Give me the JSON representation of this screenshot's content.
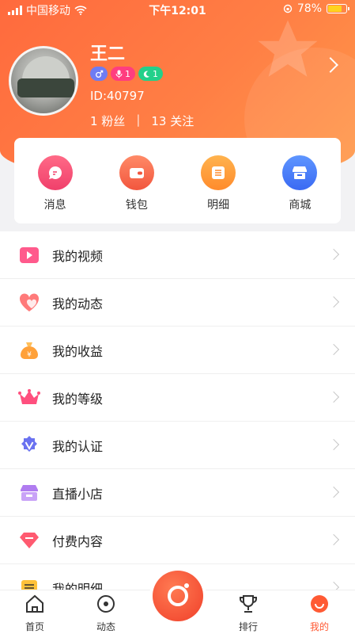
{
  "status_bar": {
    "carrier": "中国移动",
    "time": "下午12:01",
    "battery": "78%",
    "battery_level": 0.78
  },
  "profile": {
    "name": "王二",
    "badge_level_1": "1",
    "badge_level_2": "1",
    "id_text": "ID:40797",
    "fans": "1 粉丝",
    "separator": "|",
    "follows": "13 关注"
  },
  "quick_actions": [
    {
      "label": "消息",
      "icon": "message-icon"
    },
    {
      "label": "钱包",
      "icon": "wallet-icon"
    },
    {
      "label": "明细",
      "icon": "list-icon"
    },
    {
      "label": "商城",
      "icon": "store-icon"
    }
  ],
  "menu": [
    {
      "label": "我的视频",
      "icon": "video-icon",
      "color": "#ff5a8c"
    },
    {
      "label": "我的动态",
      "icon": "hearts-icon",
      "color": "#ff6f6f"
    },
    {
      "label": "我的收益",
      "icon": "moneybag-icon",
      "color": "#ffa13a"
    },
    {
      "label": "我的等级",
      "icon": "crown-icon",
      "color": "#ff4f7e"
    },
    {
      "label": "我的认证",
      "icon": "verified-icon",
      "color": "#6a72f0"
    },
    {
      "label": "直播小店",
      "icon": "shop-icon",
      "color": "#b07cf0"
    },
    {
      "label": "付费内容",
      "icon": "diamond-icon",
      "color": "#ff5a70"
    },
    {
      "label": "我的明细",
      "icon": "detail-icon",
      "color": "#ffc23a"
    }
  ],
  "tabbar": [
    {
      "label": "首页",
      "icon": "home-icon"
    },
    {
      "label": "动态",
      "icon": "feed-icon"
    },
    {
      "label": "排行",
      "icon": "trophy-icon"
    },
    {
      "label": "我的",
      "icon": "me-icon",
      "active": true
    }
  ],
  "colors": {
    "accent": "#ff6a3d",
    "active_tab": "#ff5a34"
  }
}
